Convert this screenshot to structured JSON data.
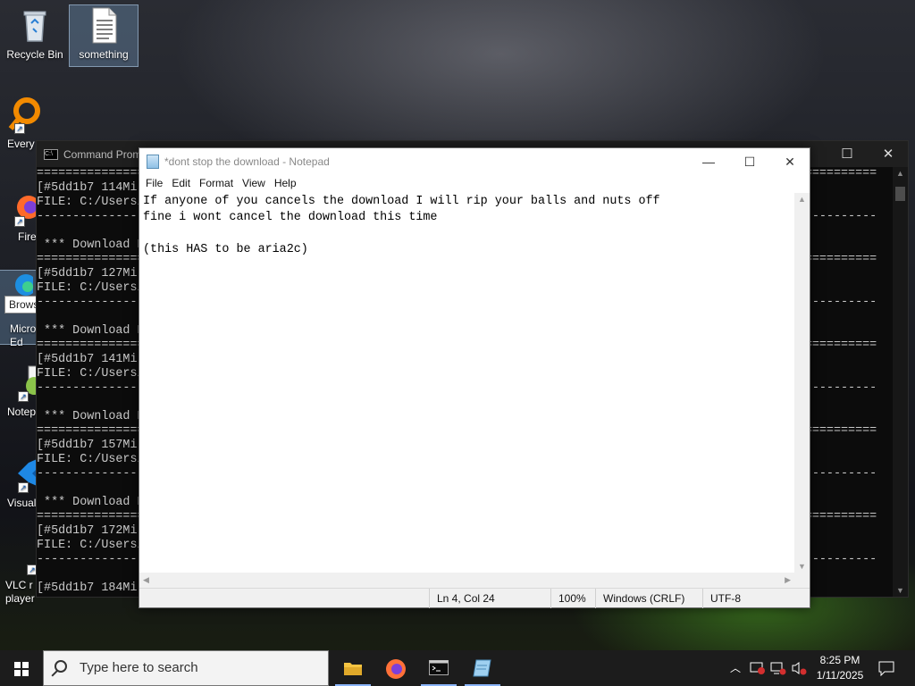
{
  "desktop": {
    "icons": [
      {
        "label": "Recycle Bin"
      },
      {
        "label": "something"
      },
      {
        "label": "Every"
      },
      {
        "label": "Fire"
      },
      {
        "label": "Micro Ed"
      },
      {
        "label": "Notep"
      },
      {
        "label": "Visual Co"
      },
      {
        "label": "VLC r player"
      }
    ],
    "tooltip": "Browse the web"
  },
  "cmd": {
    "title": "Command Prom",
    "lines": [
      "=====================================================================================================================",
      "[#5dd1b7 114Mi",
      "FILE: C:/Users/",
      "---------------------------------------------------------------------------------------------------------------------",
      "",
      " *** Download P",
      "=====================================================================================================================",
      "[#5dd1b7 127Mi",
      "FILE: C:/Users/",
      "---------------------------------------------------------------------------------------------------------------------",
      "",
      " *** Download P",
      "=====================================================================================================================",
      "[#5dd1b7 141Mi",
      "FILE: C:/Users/",
      "---------------------------------------------------------------------------------------------------------------------",
      "",
      " *** Download P",
      "=====================================================================================================================",
      "[#5dd1b7 157Mi",
      "FILE: C:/Users/",
      "---------------------------------------------------------------------------------------------------------------------",
      "",
      " *** Download P",
      "=====================================================================================================================",
      "[#5dd1b7 172Mi",
      "FILE: C:/Users/",
      "---------------------------------------------------------------------------------------------------------------------",
      "",
      "[#5dd1b7 184Mi"
    ]
  },
  "notepad": {
    "title": "*dont stop the download - Notepad",
    "menu": [
      "File",
      "Edit",
      "Format",
      "View",
      "Help"
    ],
    "content": "If anyone of you cancels the download I will rip your balls and nuts off\nfine i wont cancel the download this time\n\n(this HAS to be aria2c)",
    "status": {
      "position": "Ln 4, Col 24",
      "zoom": "100%",
      "line_ending": "Windows (CRLF)",
      "encoding": "UTF-8"
    }
  },
  "taskbar": {
    "search_placeholder": "Type here to search",
    "time": "8:25 PM",
    "date": "1/11/2025"
  }
}
